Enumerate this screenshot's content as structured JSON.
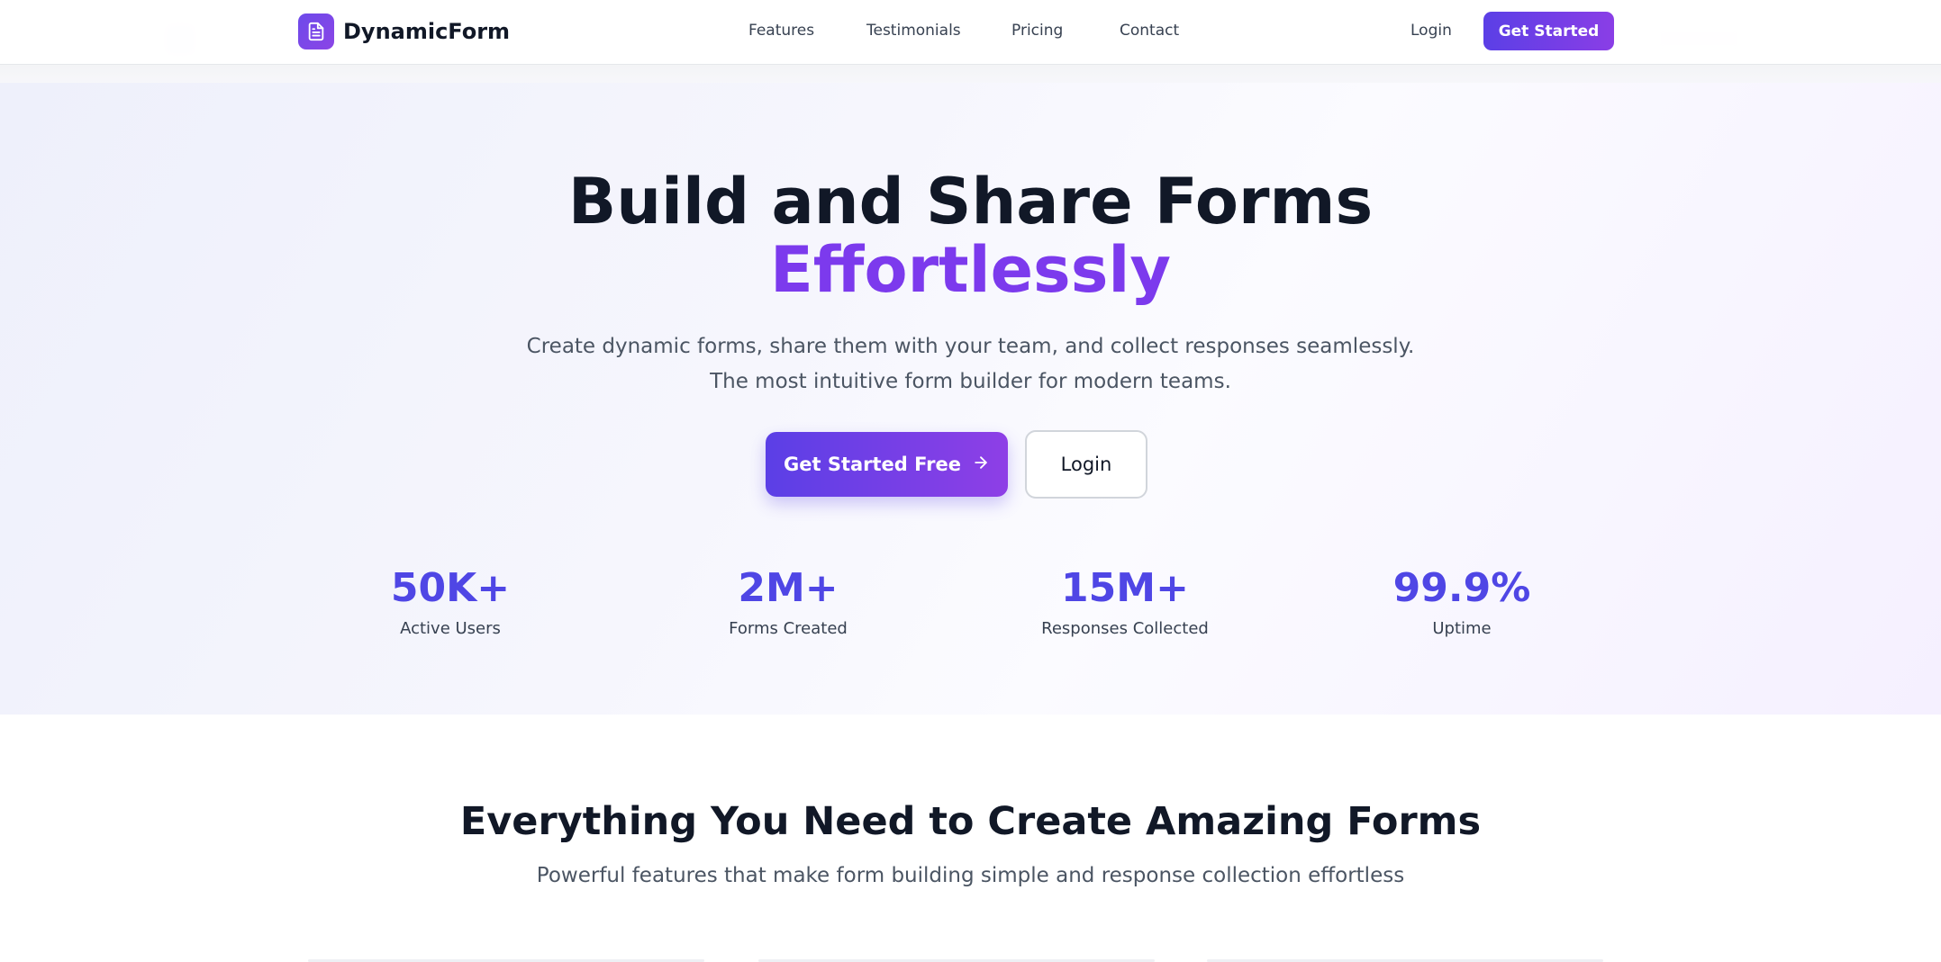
{
  "brand": {
    "name": "DynamicForm",
    "icon": "document-icon"
  },
  "nav": {
    "links": [
      "Features",
      "Testimonials",
      "Pricing",
      "Contact"
    ],
    "login": "Login",
    "cta": "Get Started"
  },
  "hero": {
    "title_line1": "Build and Share Forms",
    "title_line2": "Effortlessly",
    "subtitle_line1": "Create dynamic forms, share them with your team, and collect responses seamlessly.",
    "subtitle_line2": "The most intuitive form builder for modern teams.",
    "primary_cta": "Get Started Free",
    "primary_icon": "arrow-right-icon",
    "secondary_cta": "Login"
  },
  "stats": [
    {
      "value": "50K+",
      "label": "Active Users"
    },
    {
      "value": "2M+",
      "label": "Forms Created"
    },
    {
      "value": "15M+",
      "label": "Responses Collected"
    },
    {
      "value": "99.9%",
      "label": "Uptime"
    }
  ],
  "features": {
    "title": "Everything You Need to Create Amazing Forms",
    "subtitle": "Powerful features that make form building simple and response collection effortless"
  },
  "colors": {
    "primary": "#5b3fe6",
    "accent": "#7c3aed",
    "stat": "#4f46e5"
  }
}
